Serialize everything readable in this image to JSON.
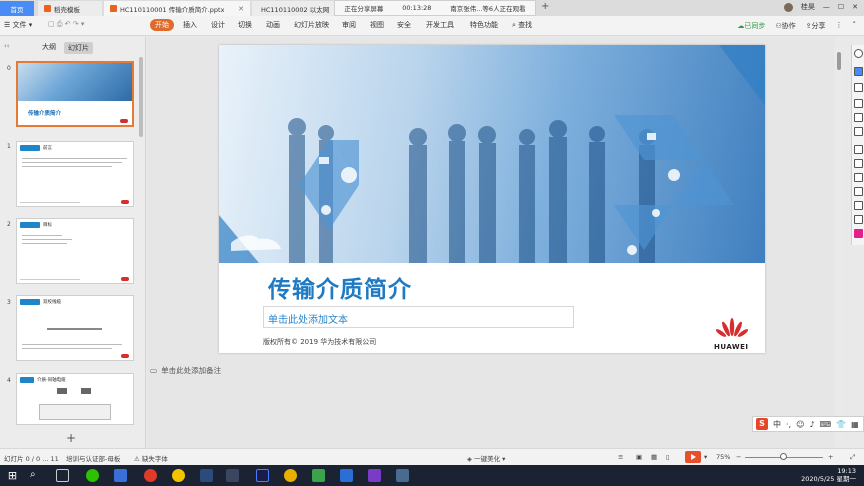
{
  "titlebar": {
    "home_tab": "首页",
    "tabs": [
      {
        "label": "稻壳模板"
      },
      {
        "label": "HC110110001 传输介质简介.pptx"
      },
      {
        "label": "HC110110002 以太网"
      }
    ],
    "share_bar": {
      "status": "正在分享屏幕",
      "timer": "00:13:28",
      "viewers": "南京张伟...等6人正在观看"
    },
    "user_name": "桂昊"
  },
  "menubar": {
    "file": "文件",
    "items": [
      "开始",
      "插入",
      "设计",
      "切换",
      "动画",
      "幻灯片放映",
      "审阅",
      "视图",
      "安全",
      "开发工具",
      "特色功能"
    ],
    "search": "查找",
    "sync": "已同步",
    "collab": "协作",
    "share": "分享"
  },
  "left_panel": {
    "tabs": [
      "大纲",
      "幻灯片"
    ],
    "slides": [
      {
        "num": "0",
        "title": "传输介质简介"
      },
      {
        "num": "1",
        "title": "前言"
      },
      {
        "num": "2",
        "title": "目标"
      },
      {
        "num": "3",
        "title": "双绞线缆"
      },
      {
        "num": "4",
        "title": "介质-同轴电缆"
      }
    ]
  },
  "slide": {
    "title": "传输介质简介",
    "subtitle_placeholder": "单击此处添加文本",
    "copyright": "版权所有© 2019 华为技术有限公司",
    "logo_text": "HUAWEI"
  },
  "notes_placeholder": "单击此处添加备注",
  "ime": {
    "logo": "S",
    "lang": "中"
  },
  "statusbar": {
    "slide_pos": "幻灯片 0 / 0 ... 11",
    "template": "培训与认证部-母板",
    "missing_font": "缺失字体",
    "beautify": "一键美化",
    "zoom": "75%"
  },
  "taskbar": {
    "time": "19:13",
    "date": "2020/5/25 星期一"
  },
  "colors": {
    "accent": "#e06a2b",
    "brand_blue": "#1f7ac4",
    "huawei_red": "#d62e2e"
  }
}
